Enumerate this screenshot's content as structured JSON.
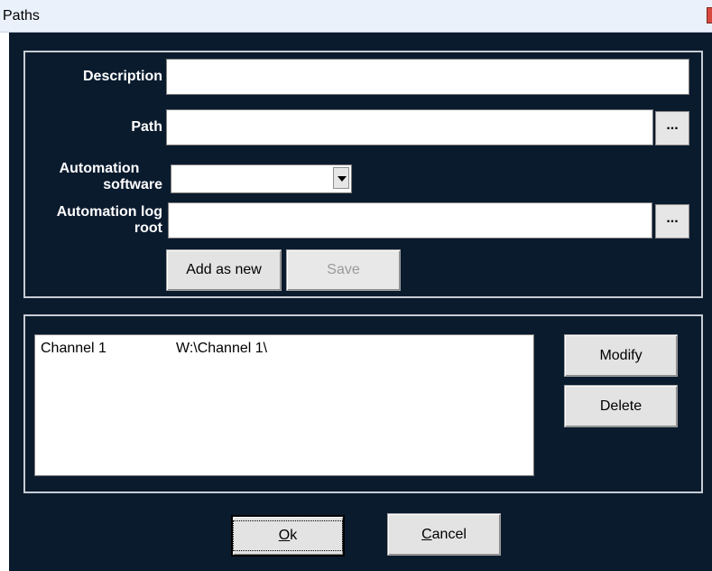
{
  "window": {
    "title": "Paths",
    "close_icon": "close-icon"
  },
  "form": {
    "description_label": "Description",
    "description_value": "",
    "path_label": "Path",
    "path_value": "",
    "path_browse_label": "...",
    "automation_software_label_line1": "Automation",
    "automation_software_label_line2": "software",
    "automation_software_selected": "",
    "automation_log_root_label_line1": "Automation log",
    "automation_log_root_label_line2": "root",
    "automation_log_root_value": "",
    "log_browse_label": "...",
    "add_as_new_label": "Add as new",
    "save_label": "Save"
  },
  "paths_list": {
    "rows": [
      {
        "channel": "Channel 1",
        "path": "W:\\Channel 1\\"
      }
    ]
  },
  "side_buttons": {
    "modify_label": "Modify",
    "delete_label": "Delete"
  },
  "footer": {
    "ok_mnemonic": "O",
    "ok_rest": "k",
    "cancel_mnemonic": "C",
    "cancel_rest": "ancel"
  },
  "colors": {
    "background": "#0b1b2e",
    "titlebar": "#eaf1fa",
    "close_button": "#d9483e"
  }
}
